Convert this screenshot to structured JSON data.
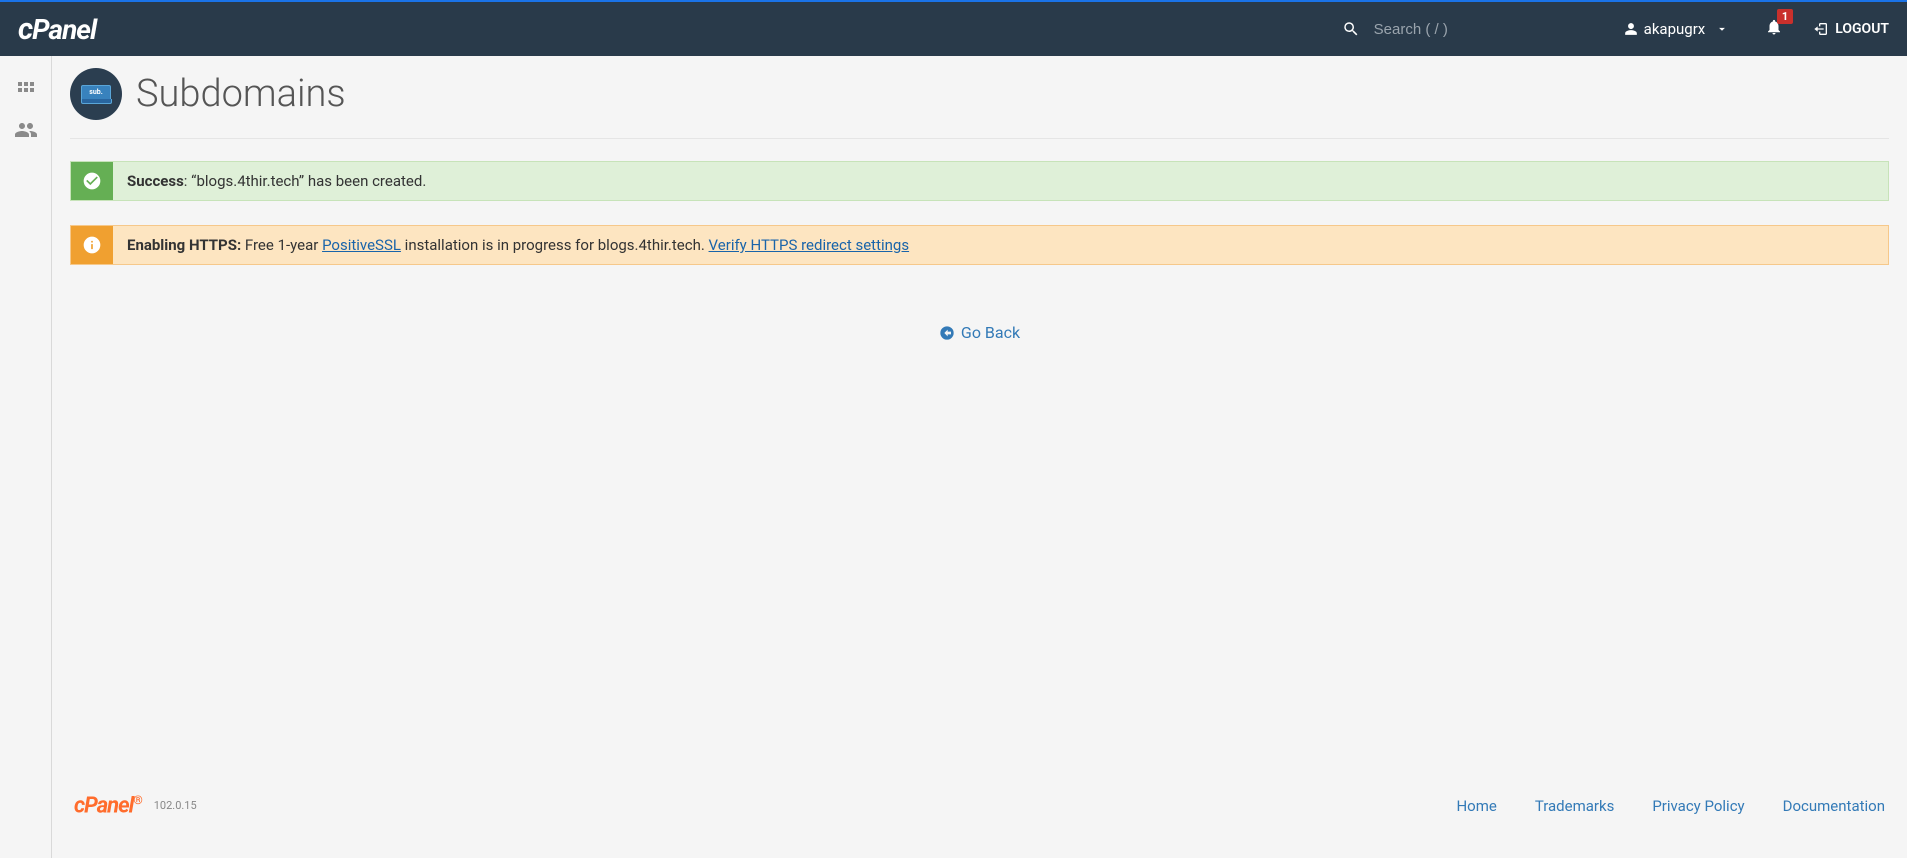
{
  "header": {
    "search_placeholder": "Search ( / )",
    "username": "akapugrx",
    "notification_count": "1",
    "logout_label": "LOGOUT"
  },
  "page": {
    "icon_text": "sub.",
    "title": "Subdomains"
  },
  "alerts": {
    "success": {
      "label": "Success",
      "separator": ": ",
      "message": "“blogs.4thir.tech” has been created."
    },
    "info": {
      "label": "Enabling HTTPS:",
      "pre": " Free 1-year ",
      "link1": "PositiveSSL",
      "mid": " installation is in progress for blogs.4thir.tech. ",
      "link2": "Verify HTTPS redirect settings"
    }
  },
  "go_back_label": "Go Back",
  "footer": {
    "version": "102.0.15",
    "links": {
      "home": "Home",
      "trademarks": "Trademarks",
      "privacy": "Privacy Policy",
      "docs": "Documentation"
    }
  }
}
